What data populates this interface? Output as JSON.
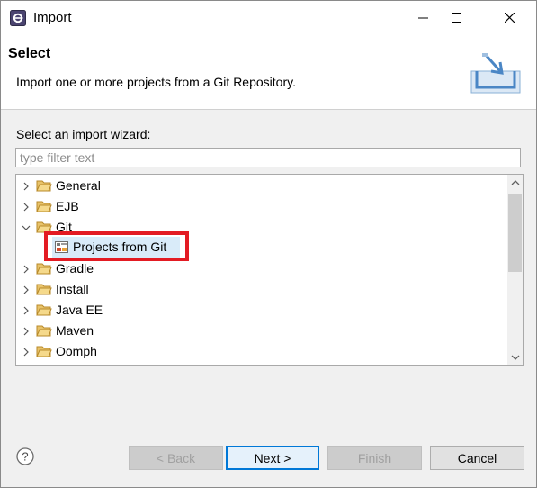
{
  "window": {
    "title": "Import"
  },
  "header": {
    "title": "Select",
    "description": "Import one or more projects from a Git Repository."
  },
  "wizard": {
    "prompt": "Select an import wizard:",
    "filter_placeholder": "type filter text",
    "filter_value": ""
  },
  "tree": {
    "items": [
      {
        "label": "General",
        "expanded": false
      },
      {
        "label": "EJB",
        "expanded": false
      },
      {
        "label": "Git",
        "expanded": true
      },
      {
        "label": "Projects from Git",
        "child": true,
        "selected": true
      },
      {
        "label": "Gradle",
        "expanded": false
      },
      {
        "label": "Install",
        "expanded": false
      },
      {
        "label": "Java EE",
        "expanded": false
      },
      {
        "label": "Maven",
        "expanded": false
      },
      {
        "label": "Oomph",
        "expanded": false
      }
    ]
  },
  "buttons": {
    "back": "< Back",
    "next": "Next >",
    "finish": "Finish",
    "cancel": "Cancel"
  },
  "colors": {
    "selection": "#d9ebf9",
    "highlight": "#e31b23",
    "folder": "#e8c36a"
  }
}
